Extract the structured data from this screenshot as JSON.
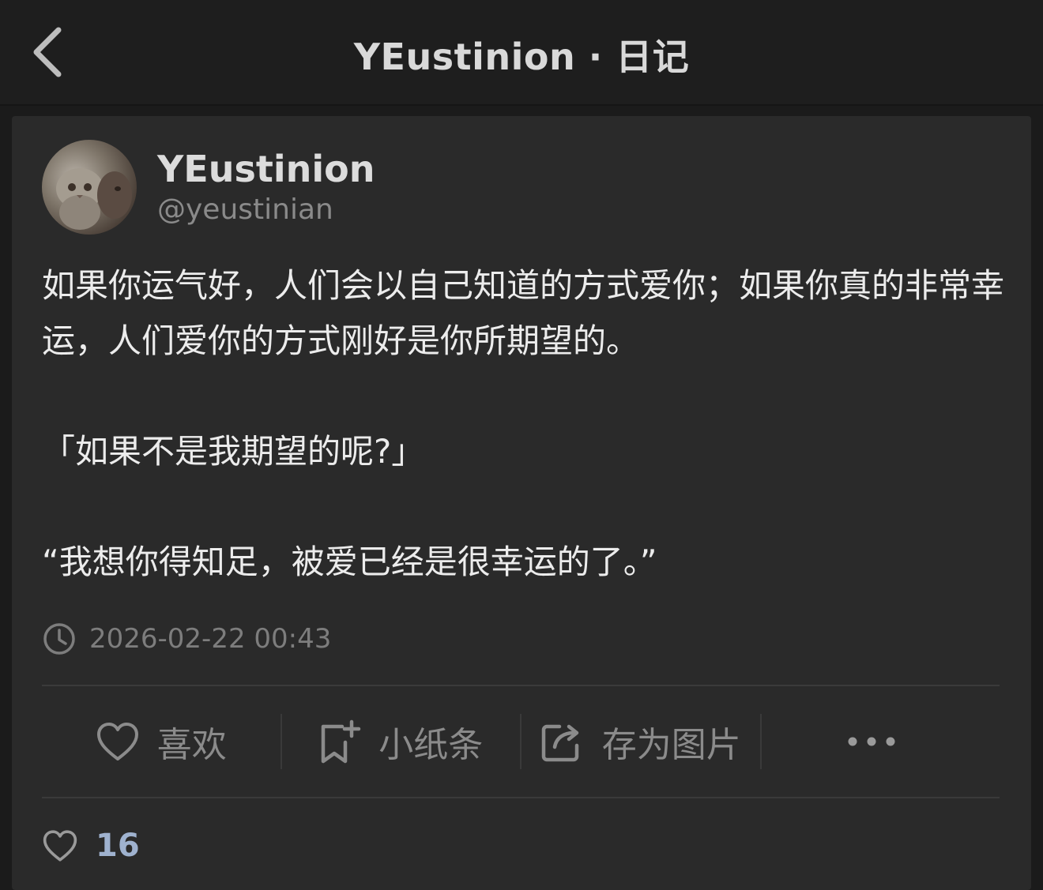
{
  "header": {
    "title": "YEustinion · 日记",
    "back_icon": "chevron-left-icon"
  },
  "author": {
    "name": "YEustinion",
    "handle": "@yeustinian"
  },
  "post": {
    "paragraphs": [
      "如果你运气好，人们会以自己知道的方式爱你；如果你真的非常幸运，人们爱你的方式刚好是你所期望的。",
      "「如果不是我期望的呢?」",
      "“我想你得知足，被爱已经是很幸运的了。”"
    ],
    "timestamp": "2026-02-22 00:43"
  },
  "actions": {
    "like_label": "喜欢",
    "note_label": "小纸条",
    "save_image_label": "存为图片",
    "more_icon": "more-dots-icon"
  },
  "stats": {
    "like_count": "16"
  },
  "colors": {
    "background": "#1b1b1b",
    "card": "#2a2a2a",
    "text": "#ececec",
    "muted": "#8b8b8b",
    "like_count": "#9fb2cf"
  }
}
